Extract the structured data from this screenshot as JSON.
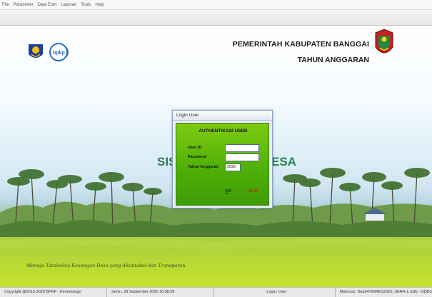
{
  "menu": [
    "File",
    "Parameter",
    "Data Entri",
    "Laporan",
    "Tools",
    "Help"
  ],
  "header": {
    "government": "PEMERINTAH KABUPATEN BANGGAI",
    "budget_year_label": "TAHUN ANGGARAN",
    "logo_text": "bpkp"
  },
  "app_title_left": "SIS",
  "app_title_right": "ESA",
  "motto": "Menuju Tatakelola Keuangan Desa yang Akuntabel dan Transparan",
  "login": {
    "window_title": "Login User",
    "heading": "AUTHENTIKASI USER",
    "user_id_label": "User ID",
    "user_id_value": "",
    "password_label": "Password",
    "password_value": "",
    "year_label": "Tahun Anggaran",
    "year_value": "2020",
    "ok_label": "OK",
    "exit_label": "Exit"
  },
  "status": {
    "copyright": "Copyright @2015-2020 BPKP - Kemendagri",
    "datetime": "Senin, 28 September 2020  10:08:58",
    "user": "Login: User",
    "db": "Mykcoss: Data/4790RES2020_SERA-1.mdb - ODBC"
  }
}
